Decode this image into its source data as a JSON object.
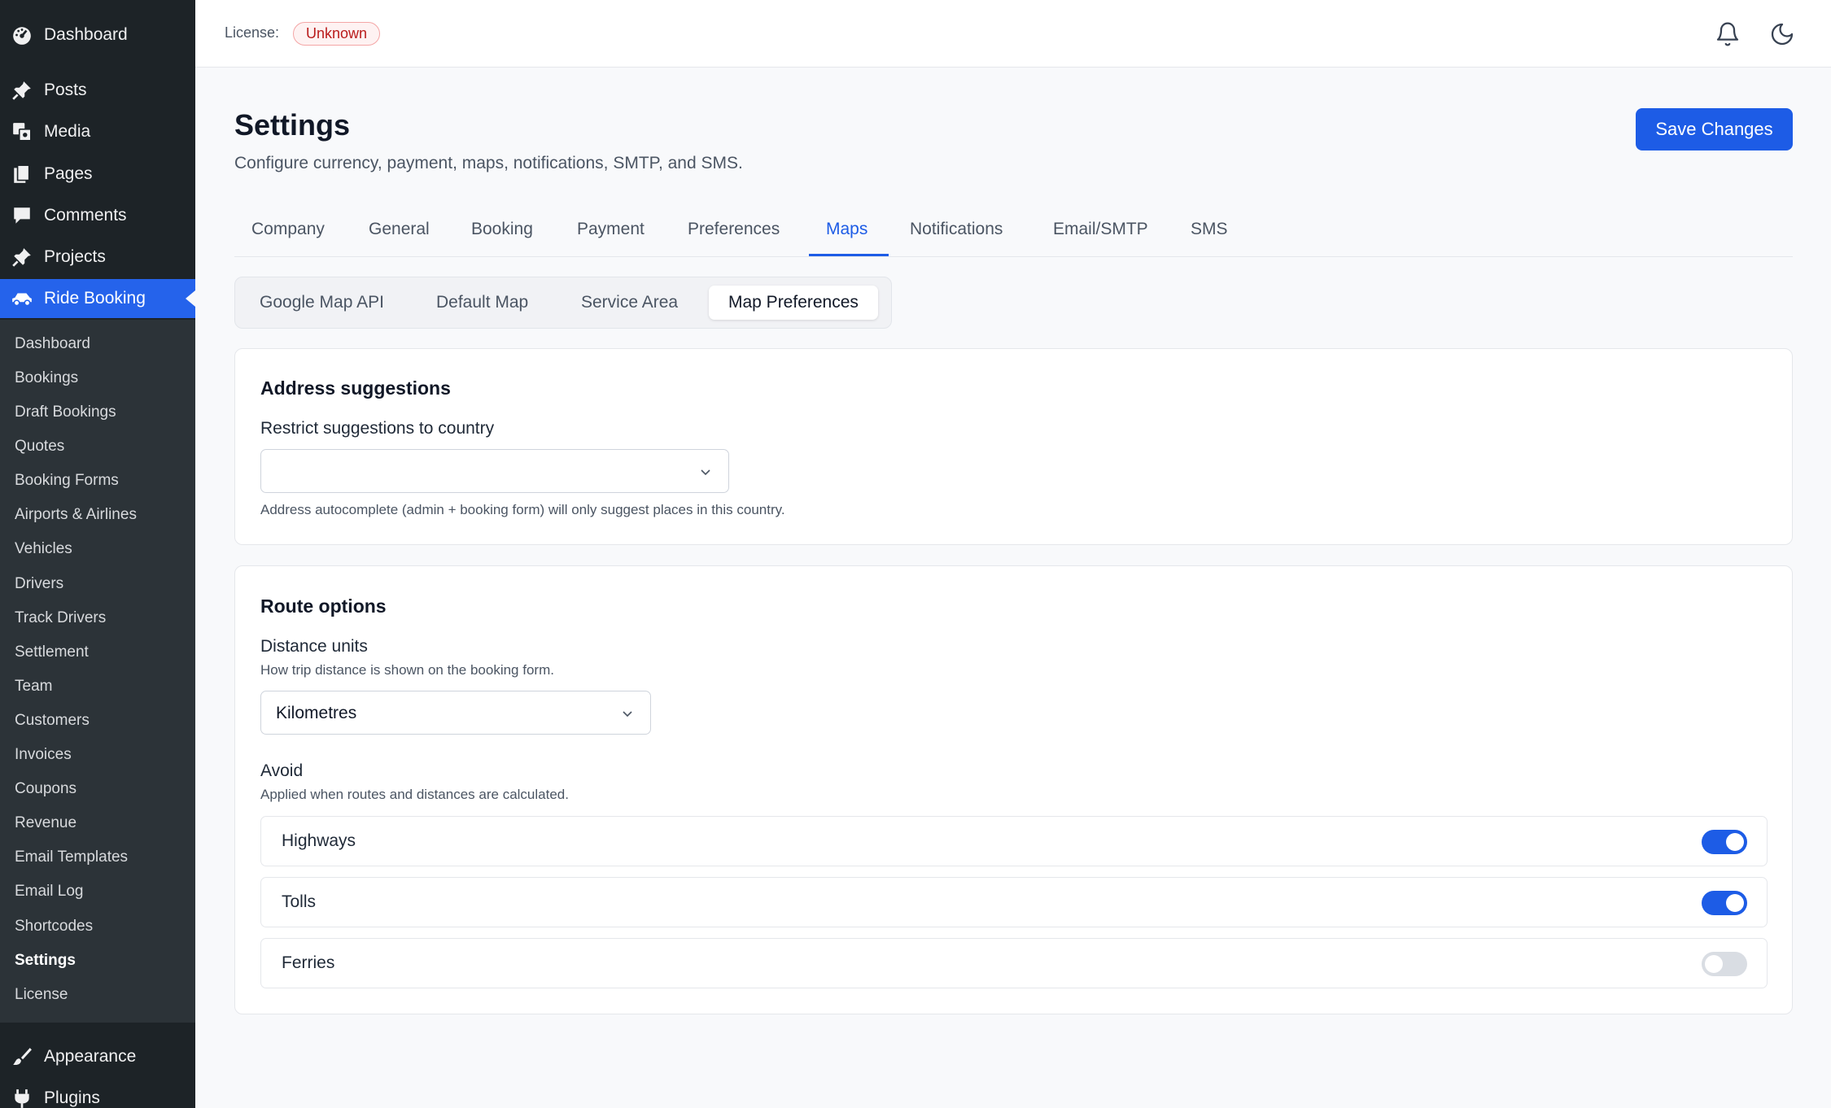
{
  "sidebar": {
    "menu_top": [
      {
        "label": "Dashboard",
        "icon": "dashboard-icon"
      },
      {
        "label": "Posts",
        "icon": "pin-icon"
      },
      {
        "label": "Media",
        "icon": "media-icon"
      },
      {
        "label": "Pages",
        "icon": "pages-icon"
      },
      {
        "label": "Comments",
        "icon": "comment-icon"
      },
      {
        "label": "Projects",
        "icon": "pin-icon"
      },
      {
        "label": "Ride Booking",
        "icon": "car-icon",
        "active": true
      }
    ],
    "submenu": [
      "Dashboard",
      "Bookings",
      "Draft Bookings",
      "Quotes",
      "Booking Forms",
      "Airports & Airlines",
      "Vehicles",
      "Drivers",
      "Track Drivers",
      "Settlement",
      "Team",
      "Customers",
      "Invoices",
      "Coupons",
      "Revenue",
      "Email Templates",
      "Email Log",
      "Shortcodes",
      "Settings",
      "License"
    ],
    "submenu_current": "Settings",
    "menu_bottom": [
      {
        "label": "Appearance",
        "icon": "brush-icon"
      },
      {
        "label": "Plugins",
        "icon": "plugin-icon"
      }
    ]
  },
  "topbar": {
    "license_label": "License:",
    "license_status": "Unknown",
    "icons": [
      "bell-icon",
      "moon-icon"
    ]
  },
  "header": {
    "title": "Settings",
    "description": "Configure currency, payment, maps, notifications, SMTP, and SMS.",
    "save_label": "Save Changes"
  },
  "tabs": [
    "Company",
    "General",
    "Booking",
    "Payment",
    "Preferences",
    "Maps",
    "Notifications",
    "Email/SMTP",
    "SMS"
  ],
  "active_tab": "Maps",
  "subtabs": [
    "Google Map API",
    "Default Map",
    "Service Area",
    "Map Preferences"
  ],
  "active_subtab": "Map Preferences",
  "address_card": {
    "title": "Address suggestions",
    "field_label": "Restrict suggestions to country",
    "country_value": "",
    "help": "Address autocomplete (admin + booking form) will only suggest places in this country."
  },
  "route_card": {
    "title": "Route options",
    "distance_label": "Distance units",
    "distance_help": "How trip distance is shown on the booking form.",
    "distance_value": "Kilometres",
    "avoid_label": "Avoid",
    "avoid_help": "Applied when routes and distances are calculated.",
    "avoid_options": [
      {
        "label": "Highways",
        "enabled": true
      },
      {
        "label": "Tolls",
        "enabled": true
      },
      {
        "label": "Ferries",
        "enabled": false
      }
    ]
  },
  "colors": {
    "accent": "#1d5ce6",
    "sidebar_bg": "#1d2327",
    "badge_red": "#b91c1c"
  }
}
